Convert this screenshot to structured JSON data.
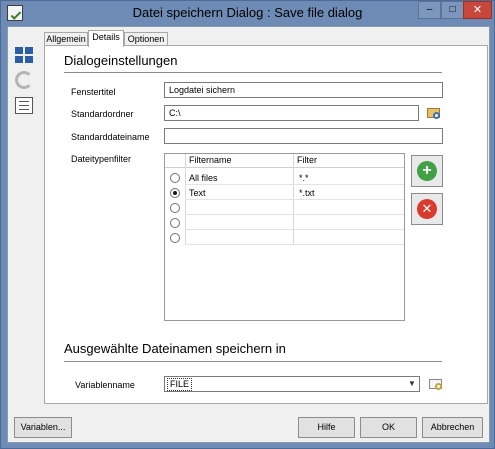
{
  "window": {
    "title": "Datei speichern Dialog : Save file dialog",
    "minimize_glyph": "–",
    "maximize_glyph": "□",
    "close_glyph": "✕"
  },
  "tabs": [
    {
      "label": "Allgemein",
      "active": false
    },
    {
      "label": "Details",
      "active": true
    },
    {
      "label": "Optionen",
      "active": false
    }
  ],
  "dialog_settings": {
    "heading": "Dialogeinstellungen",
    "window_title_label": "Fenstertitel",
    "window_title_value": "Logdatei sichern",
    "default_folder_label": "Standardordner",
    "default_folder_value": "C:\\",
    "default_filename_label": "Standarddateiname",
    "default_filename_value": "",
    "filetype_filter_label": "Dateitypenfilter"
  },
  "filter_grid": {
    "columns": [
      "Filtername",
      "Filter"
    ],
    "rows": [
      {
        "name": "All files",
        "filter": "*.*",
        "selected": false
      },
      {
        "name": "Text",
        "filter": "*.txt",
        "selected": true
      },
      {
        "name": "",
        "filter": "",
        "selected": false
      },
      {
        "name": "",
        "filter": "",
        "selected": false
      },
      {
        "name": "",
        "filter": "",
        "selected": false
      }
    ],
    "add_glyph": "+",
    "delete_glyph": "✕"
  },
  "save_target": {
    "heading": "Ausgewählte Dateinamen speichern in",
    "variable_label": "Variablenname",
    "variable_value": "FILE",
    "dropdown_glyph": "▼"
  },
  "footer": {
    "variables_label": "Variablen...",
    "help_label": "Hilfe",
    "ok_label": "OK",
    "cancel_label": "Abbrechen"
  },
  "colors": {
    "title_bar": "#6e8bb5",
    "add_button": "#43a047",
    "delete_button": "#d83b2b",
    "close_button": "#c7473a"
  },
  "icons": {
    "sidebar": [
      "dashboard-grid-icon",
      "refresh-icon",
      "document-list-icon"
    ],
    "browse_folder": "folder-browse-icon",
    "browse_variable": "variable-browse-icon"
  }
}
